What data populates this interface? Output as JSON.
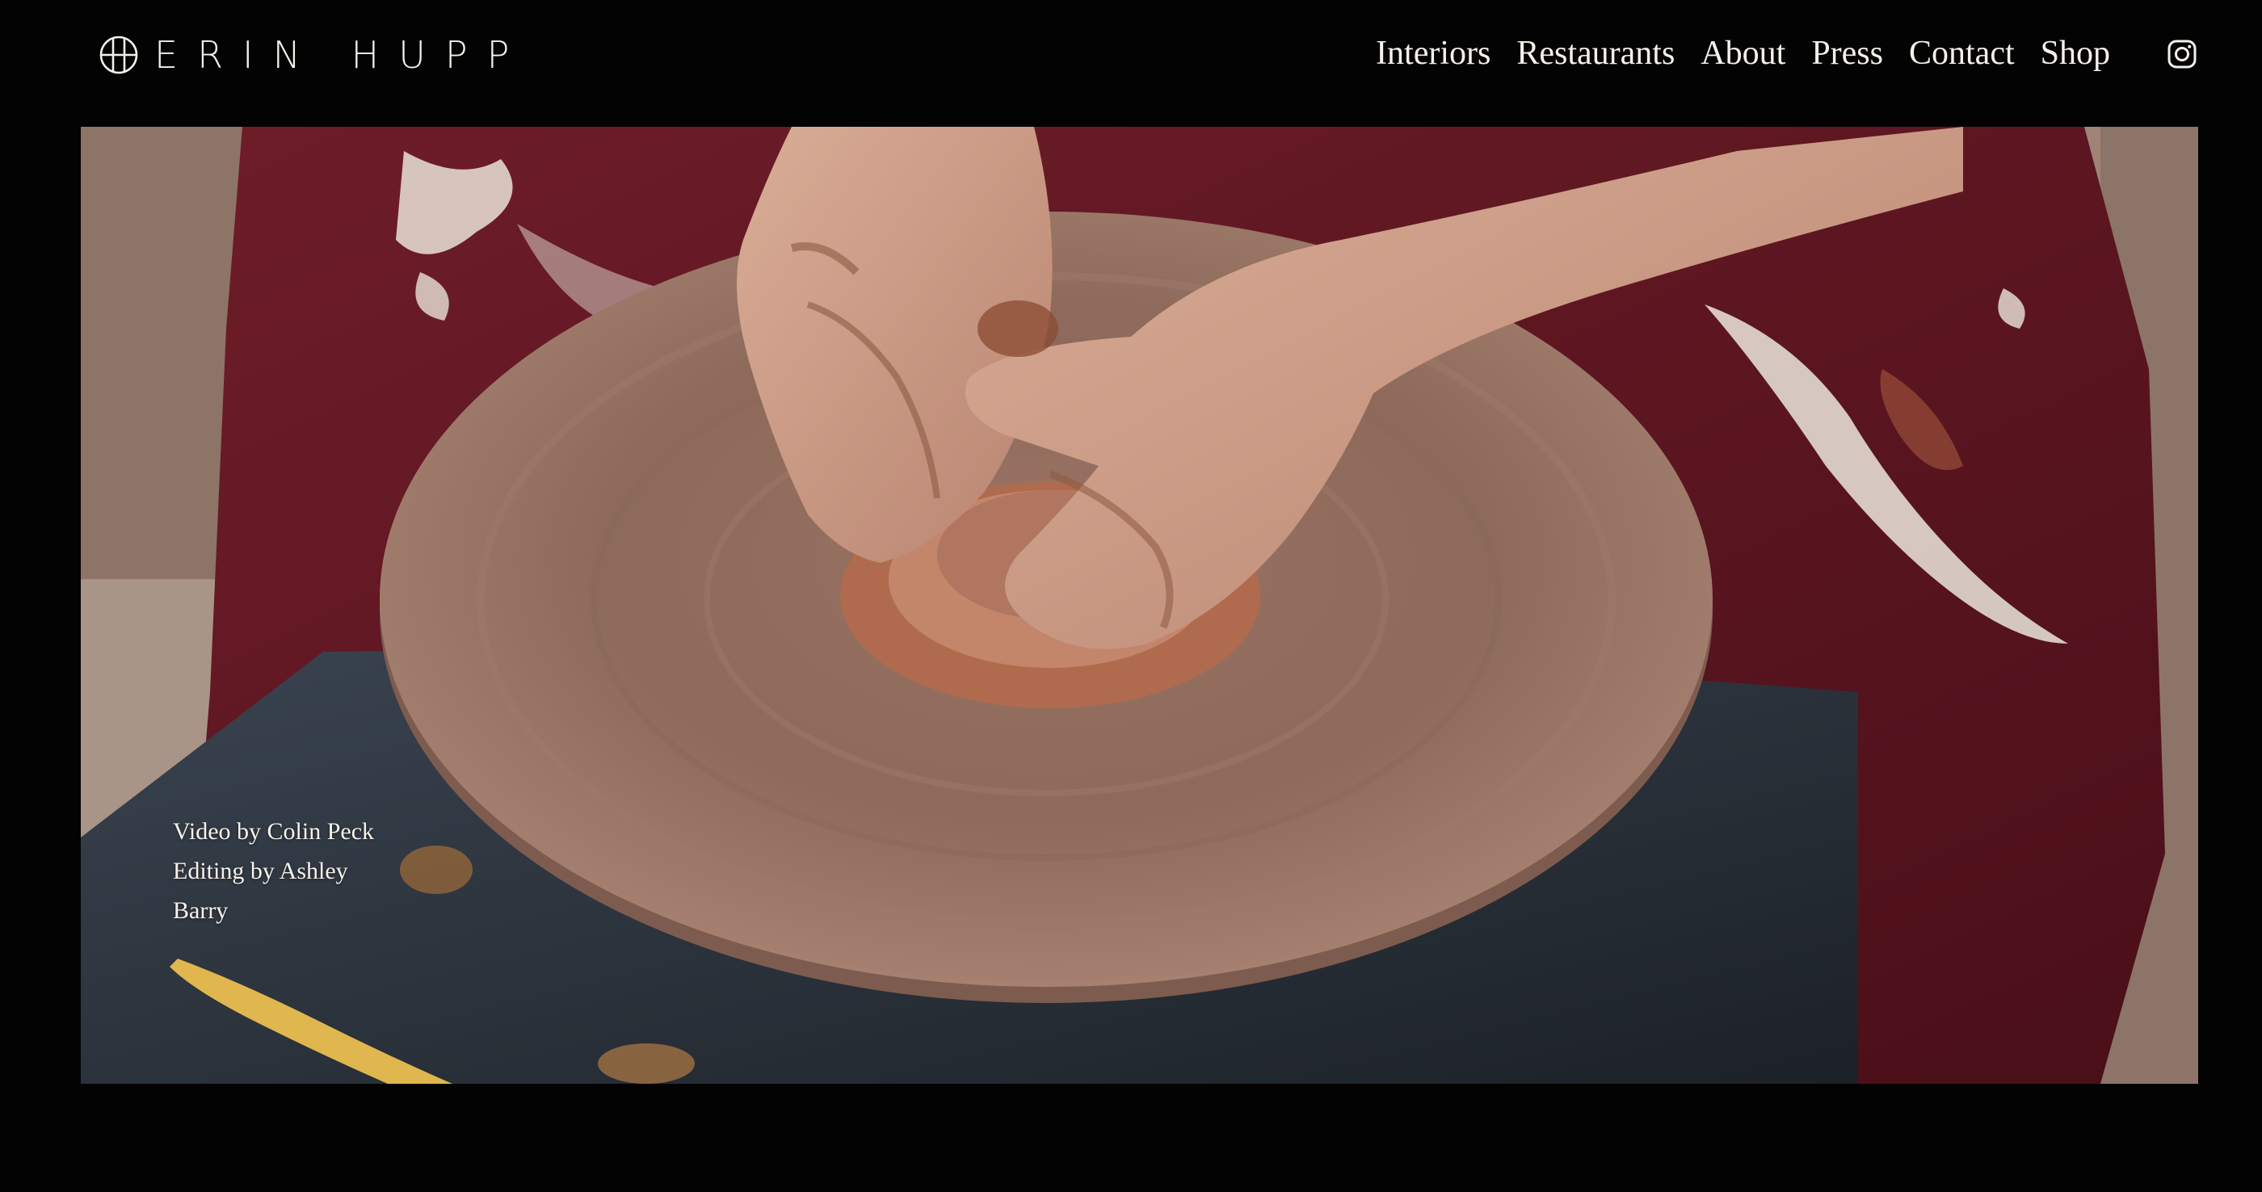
{
  "brand": {
    "name": "ERIN HUPP",
    "logo_icon": "circle-monogram-icon"
  },
  "nav": {
    "items": [
      {
        "label": "Interiors"
      },
      {
        "label": "Restaurants"
      },
      {
        "label": "About"
      },
      {
        "label": "Press"
      },
      {
        "label": "Contact"
      },
      {
        "label": "Shop"
      }
    ],
    "social_icon": "instagram-icon"
  },
  "hero": {
    "credits": {
      "line1": "Video by Colin Peck",
      "line2": "Editing by Ashley",
      "line3": "Barry"
    }
  },
  "colors": {
    "background": "#030303",
    "text": "#f5f1ea",
    "clay": "#a87866",
    "apron": "#6b1a24"
  }
}
